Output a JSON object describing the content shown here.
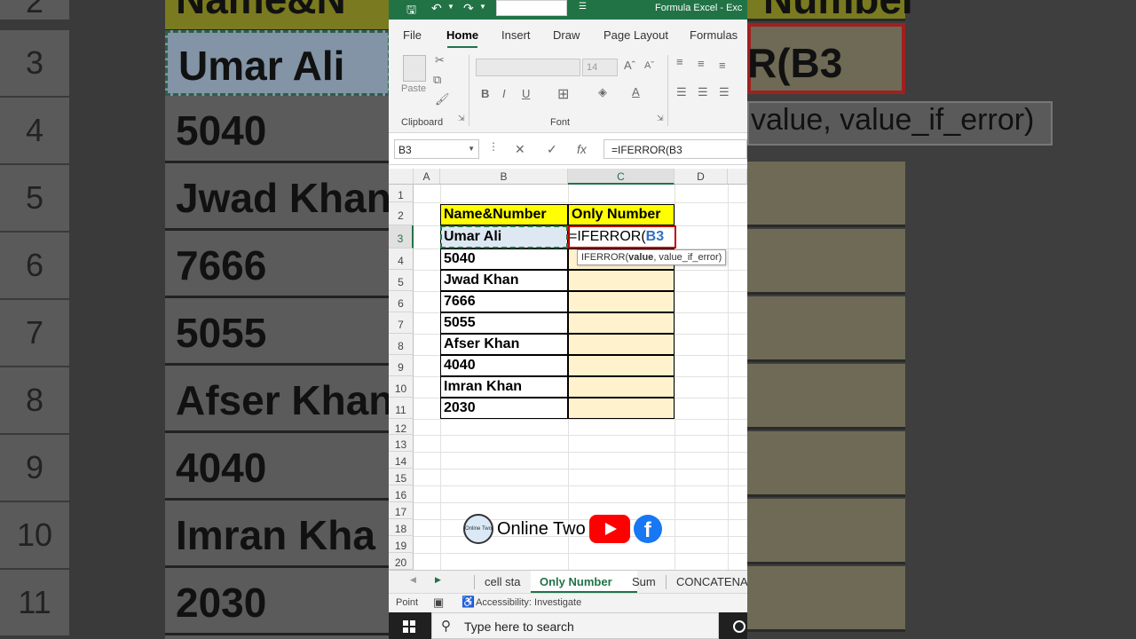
{
  "window": {
    "title": "Formula Excel  -  Exc"
  },
  "ribbon_tabs": [
    "File",
    "Home",
    "Insert",
    "Draw",
    "Page Layout",
    "Formulas"
  ],
  "ribbon": {
    "paste_label": "Paste",
    "clipboard_label": "Clipboard",
    "font_label": "Font",
    "font_size": "14",
    "bold": "B",
    "italic": "I",
    "underline": "U"
  },
  "formula_bar": {
    "name_box": "B3",
    "cancel": "✕",
    "enter": "✓",
    "fx": "fx",
    "formula": "=IFERROR(B3"
  },
  "columns": [
    "A",
    "B",
    "C",
    "D"
  ],
  "rows": [
    "1",
    "2",
    "3",
    "4",
    "5",
    "6",
    "7",
    "8",
    "9",
    "10",
    "11",
    "12",
    "13",
    "14",
    "15",
    "16",
    "17",
    "18",
    "19",
    "20"
  ],
  "table": {
    "header_b": "Name&Number",
    "header_c": "Only Number",
    "values_b": [
      "Umar Ali",
      "5040",
      "Jwad Khan",
      "7666",
      "5055",
      "Afser Khan",
      "4040",
      "Imran Khan",
      "2030"
    ],
    "editing_prefix": "=IFERROR(",
    "editing_ref": "B3"
  },
  "tooltip": {
    "fn": "IFERROR(",
    "bold_arg": "value",
    "rest": ", value_if_error)"
  },
  "watermark": {
    "logo_text": "Online Two",
    "text": "Online Two"
  },
  "sheet_tabs": [
    "cell sta",
    "Only Number",
    "Sum",
    "CONCATENAT"
  ],
  "status": {
    "mode": "Point",
    "accessibility": "Accessibility: Investigate"
  },
  "taskbar": {
    "search_placeholder": "Type here to search"
  },
  "background": {
    "rows": [
      "2",
      "3",
      "4",
      "5",
      "6",
      "7",
      "8",
      "9",
      "10",
      "11"
    ],
    "values": [
      "Name&N",
      "Umar Ali",
      "5040",
      "Jwad Khan",
      "7666",
      "5055",
      "Afser Khan",
      "4040",
      "Imran Kha",
      "2030"
    ],
    "right_header": "Number",
    "right_formula": "R(B3",
    "right_tooltip": "value, value_if_error)"
  },
  "colors": {
    "excel_green": "#217346",
    "header_yellow": "#ffff00",
    "cell_fill": "#fff2cc",
    "active_red": "#c00000"
  }
}
